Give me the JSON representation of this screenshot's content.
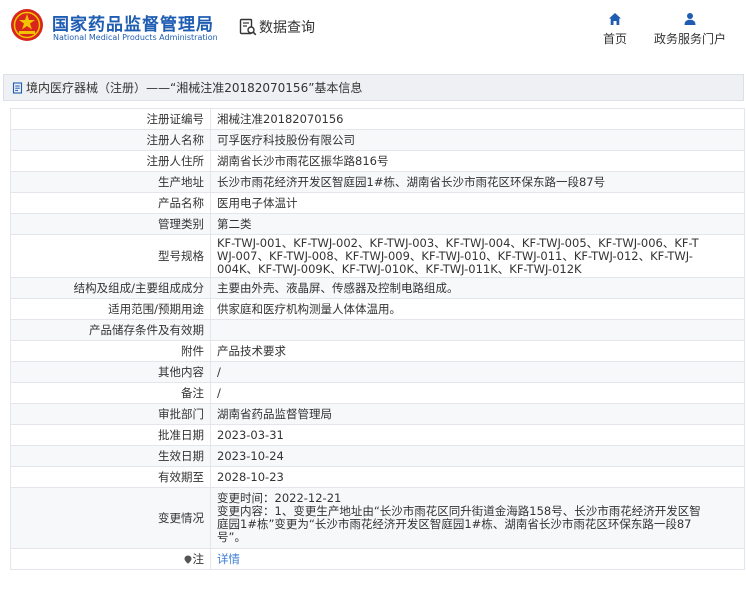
{
  "header": {
    "brand_cn": "国家药品监督管理局",
    "brand_en": "National Medical Products Administration",
    "query_label": "数据查询",
    "nav": [
      {
        "label": "首页",
        "icon": "home-icon"
      },
      {
        "label": "政务服务门户",
        "icon": "user-icon"
      }
    ]
  },
  "breadcrumb": "境内医疗器械（注册）——“湘械注准20182070156”基本信息",
  "colors": {
    "brand": "#1f5db3",
    "link": "#3d7bd6",
    "crumb_bg": "#eef0f3"
  },
  "rows": [
    {
      "label": "注册证编号",
      "lines": [
        "湘械注准20182070156"
      ]
    },
    {
      "label": "注册人名称",
      "lines": [
        "可孚医疗科技股份有限公司"
      ]
    },
    {
      "label": "注册人住所",
      "lines": [
        "湖南省长沙市雨花区振华路816号"
      ]
    },
    {
      "label": "生产地址",
      "lines": [
        "长沙市雨花经济开发区智庭园1#栋、湖南省长沙市雨花区环保东路一段87号"
      ]
    },
    {
      "label": "产品名称",
      "lines": [
        "医用电子体温计"
      ]
    },
    {
      "label": "管理类别",
      "lines": [
        "第二类"
      ]
    },
    {
      "label": "型号规格",
      "lines": [
        "KF-TWJ-001、KF-TWJ-002、KF-TWJ-003、KF-TWJ-004、KF-TWJ-005、KF-TWJ-006、KF-T",
        "WJ-007、KF-TWJ-008、KF-TWJ-009、KF-TWJ-010、KF-TWJ-011、KF-TWJ-012、KF-TWJ-",
        "004K、KF-TWJ-009K、KF-TWJ-010K、KF-TWJ-011K、KF-TWJ-012K"
      ]
    },
    {
      "label": "结构及组成/主要组成成分",
      "lines": [
        "主要由外壳、液晶屏、传感器及控制电路组成。"
      ]
    },
    {
      "label": "适用范围/预期用途",
      "lines": [
        "供家庭和医疗机构测量人体体温用。"
      ]
    },
    {
      "label": "产品储存条件及有效期",
      "lines": [
        ""
      ]
    },
    {
      "label": "附件",
      "lines": [
        "产品技术要求"
      ]
    },
    {
      "label": "其他内容",
      "lines": [
        "/"
      ]
    },
    {
      "label": "备注",
      "lines": [
        "/"
      ]
    },
    {
      "label": "审批部门",
      "lines": [
        "湖南省药品监督管理局"
      ]
    },
    {
      "label": "批准日期",
      "lines": [
        "2023-03-31"
      ]
    },
    {
      "label": "生效日期",
      "lines": [
        "2023-10-24"
      ]
    },
    {
      "label": "有效期至",
      "lines": [
        "2028-10-23"
      ]
    },
    {
      "label": "变更情况",
      "lines": [
        "变更时间：2022-12-21",
        "变更内容：1、变更生产地址由“长沙市雨花区同升街道金海路158号、长沙市雨花经济开发区智",
        "庭园1#栋”变更为“长沙市雨花经济开发区智庭园1#栋、湖南省长沙市雨花区环保东路一段87",
        "号”。"
      ]
    },
    {
      "label": "注",
      "lines": [
        "详情"
      ],
      "link": true
    }
  ]
}
